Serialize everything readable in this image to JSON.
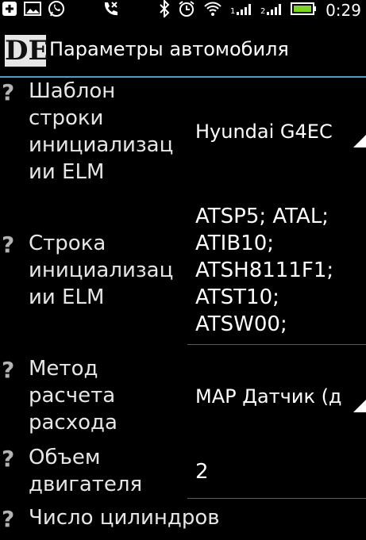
{
  "status_bar": {
    "icons_left": [
      "plus-icon",
      "image-icon",
      "whatsapp-icon",
      "phone-icon"
    ],
    "icons_right": [
      "bluetooth-icon",
      "alarm-icon",
      "wifi-icon",
      "signal-1-icon",
      "signal-2-icon",
      "battery-icon"
    ],
    "time": "0:29"
  },
  "action_bar": {
    "logo": "DE",
    "title": "Параметры автомобиля"
  },
  "settings": [
    {
      "label": "Шаблон строки инициализации ELM",
      "lines": [
        "Шаблон",
        "строки",
        "инициализац",
        "ии ELM"
      ],
      "value": "Hyundai G4EC",
      "type": "spinner"
    },
    {
      "label": "Строка инициализации ELM",
      "lines": [
        "Строка",
        "инициализац",
        "ии ELM"
      ],
      "value_lines": [
        "ATSP5; ATAL;",
        "ATIB10;",
        "ATSH8111F1;",
        "ATST10;",
        "ATSW00;"
      ],
      "type": "edit"
    },
    {
      "label": "Метод расчета расхода",
      "lines": [
        "Метод",
        "расчета",
        "расхода"
      ],
      "value": "МАР Датчик (да",
      "type": "spinner"
    },
    {
      "label": "Объем двигателя",
      "lines": [
        "Объем",
        "двигателя"
      ],
      "value": "2",
      "type": "edit"
    },
    {
      "label": "Число цилиндров",
      "lines": [
        "Число цилиндров"
      ],
      "type": "edit"
    }
  ],
  "help_mark": "?",
  "colors": {
    "background": "#000000",
    "accent_divider": "#3fa1d1",
    "label_text": "#e6e6e6",
    "help_mark": "#b3b3b3"
  }
}
